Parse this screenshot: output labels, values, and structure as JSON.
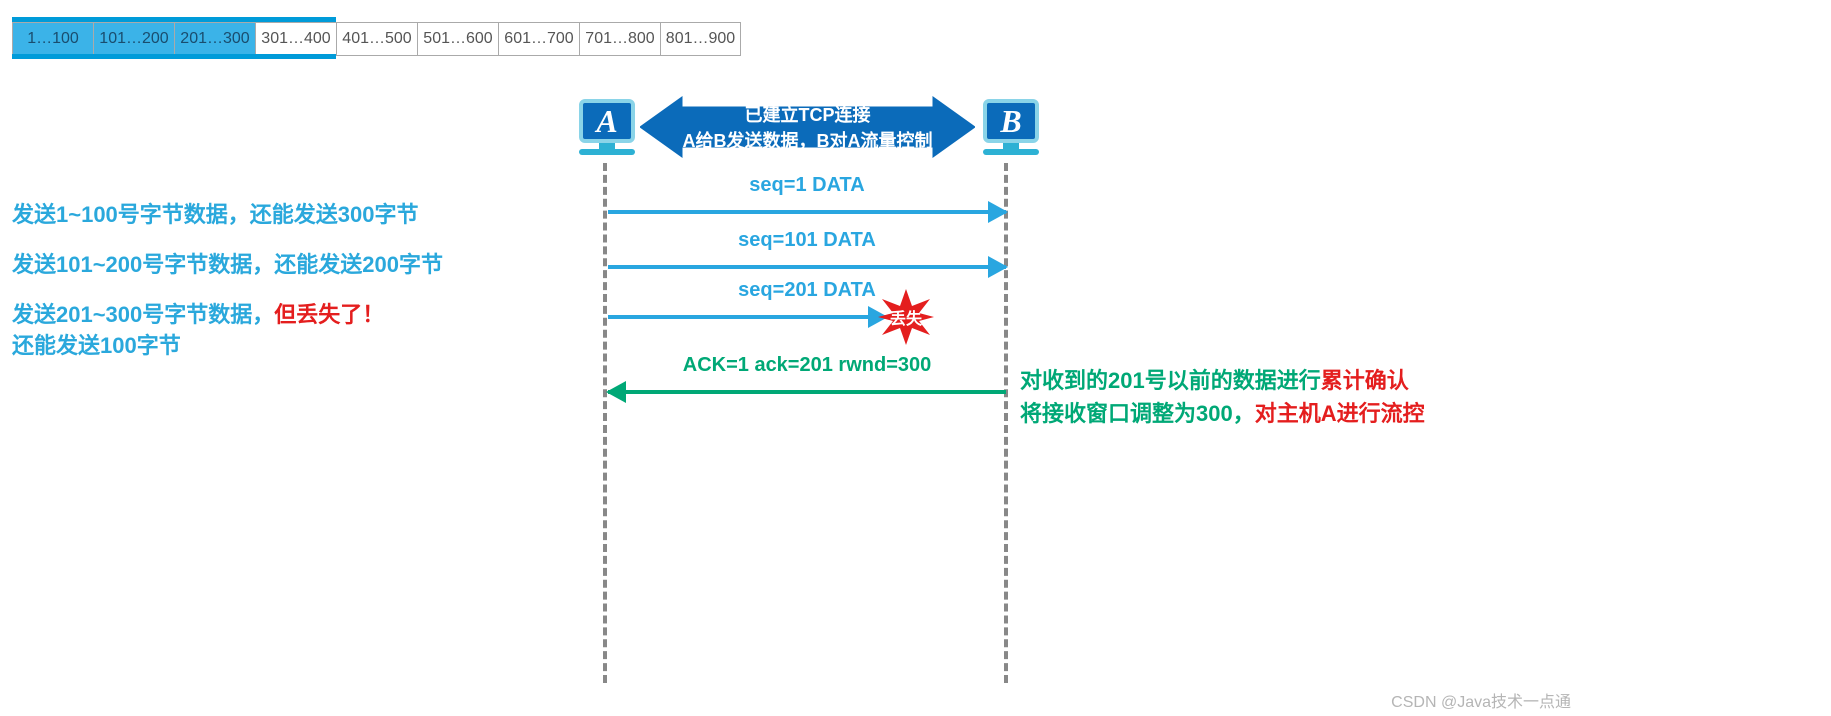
{
  "chart_data": {
    "type": "table",
    "window_cells": [
      {
        "label": "1…100",
        "highlight": true
      },
      {
        "label": "101…200",
        "highlight": true
      },
      {
        "label": "201…300",
        "highlight": true
      },
      {
        "label": "301…400",
        "highlight": false
      },
      {
        "label": "401…500",
        "highlight": false
      },
      {
        "label": "501…600",
        "highlight": false
      },
      {
        "label": "601…700",
        "highlight": false
      },
      {
        "label": "701…800",
        "highlight": false
      },
      {
        "label": "801…900",
        "highlight": false
      }
    ]
  },
  "hosts": {
    "a_label": "A",
    "b_label": "B"
  },
  "banner": {
    "line1": "已建立TCP连接",
    "line2": "A给B发送数据，B对A流量控制"
  },
  "messages": {
    "seq1": "seq=1   DATA",
    "seq101": "seq=101   DATA",
    "seq201": "seq=201   DATA",
    "ack": "ACK=1   ack=201   rwnd=300"
  },
  "loss_badge": "丢失",
  "left_annotations": {
    "line1": "发送1~100号字节数据，还能发送300字节",
    "line2": "发送101~200号字节数据，还能发送200字节",
    "line3a": "发送201~300号字节数据，",
    "line3b_red": "但丢失了！",
    "line4": "还能发送100字节"
  },
  "right_annotations": {
    "line1a": "对收到的201号以前的数据进行",
    "line1b_red": "累计确认",
    "line2a": "将接收窗口调整为300，",
    "line2b_red": "对主机A进行流控"
  },
  "watermark": "CSDN @Java技术一点通"
}
